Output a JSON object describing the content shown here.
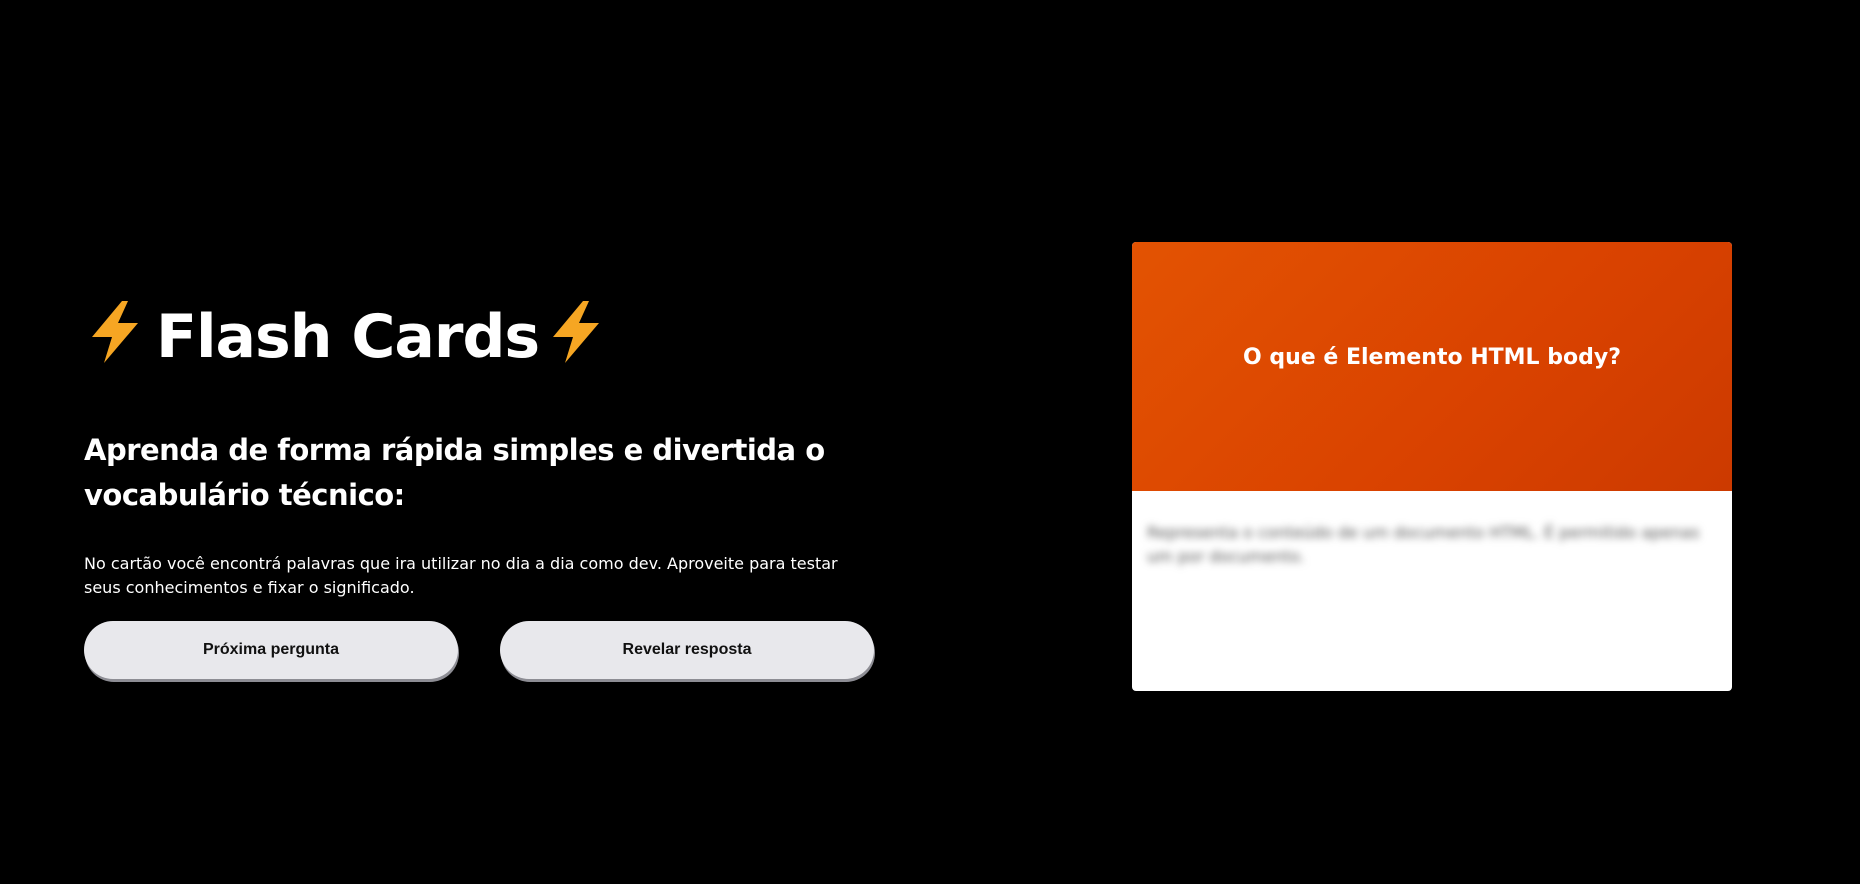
{
  "header": {
    "title": "Flash Cards",
    "icon_left": "lightning-bolt-icon",
    "icon_right": "lightning-bolt-icon",
    "bolt_color": "#f6a623"
  },
  "intro": {
    "subtitle": "Aprenda de forma rápida simples e divertida o vocabulário técnico:",
    "description": "No cartão você encontrá palavras que ira utilizar no dia a dia como dev. Aproveite para testar seus conhecimentos e fixar o significado."
  },
  "actions": {
    "next_label": "Próxima pergunta",
    "reveal_label": "Revelar resposta"
  },
  "card": {
    "question": "O que é Elemento HTML body?",
    "answer": "Representa o conteúdo de um documento HTML. É permitido apenas um por documento.",
    "answer_state": "blurred",
    "front_color": "#d94200",
    "back_color": "#ffffff"
  }
}
